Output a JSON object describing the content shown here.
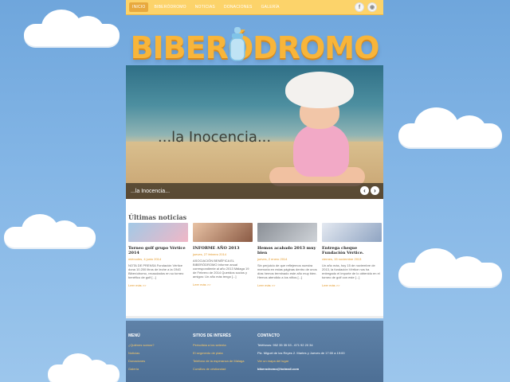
{
  "nav": {
    "items": [
      "Inicio",
      "Biberódromo",
      "Noticias",
      "Donaciones",
      "Galería"
    ],
    "active_index": 0
  },
  "social": [
    "f",
    "rss"
  ],
  "logo": {
    "text": "BIBERÓDROMO"
  },
  "slider": {
    "caption": "...la Inocencia...",
    "title": "...la Inocencia...",
    "prev": "‹",
    "next": "›"
  },
  "news": {
    "section_title": "Últimas noticias",
    "cards": [
      {
        "title": "Torneo golf grupo Vértice 2014",
        "date": "miércoles, 4 junio 2014",
        "excerpt": "NOTA DE PRENSA Fundación Vértice dona 10.200 litros de leche a la ONG Biberódromo, recaudados en su torneo benéfico de golf [...]",
        "more": "Leer más >>"
      },
      {
        "title": "INFORME AÑO 2013",
        "date": "jueves, 27 febrero 2014",
        "excerpt": "ASOCIACIÓN BENÉFICA EL BIBERÓDROMO Informe anual correspondiente al año 2013 Málaga 19 de Febrero de 2014 Queridos socios y amigos: Un año más tengo [...]",
        "more": "Leer más >>"
      },
      {
        "title": "Hemos acabado 2013 muy bien",
        "date": "jueves, 2 enero 2014",
        "excerpt": "Sin perjuicio de que reflejemos nuestra memoria en estas páginas dentro de unos días hemos terminado este año muy bien. Hemos atendido a los niños [...]",
        "more": "Leer más >>"
      },
      {
        "title": "Entrega cheque Fundación Vértice.",
        "date": "viernes, 15 noviembre 2013",
        "excerpt": "Un año más, hoy 15 de noviembre de 2013, la fundación Vértice nos ha entregado el importe de lo obtenido en el torneo de golf con este [...]",
        "more": "Leer más >>"
      }
    ]
  },
  "footer": {
    "menu": {
      "title": "Menú",
      "links": [
        "¿Quiénes somos?",
        "Noticias",
        "Donaciones",
        "Galería"
      ]
    },
    "sites": {
      "title": "Sitios de interés",
      "links": [
        "Periodista a los setenta",
        "El segmento de plata",
        "Teléfono de la esperanza de Málaga",
        "Cursillos de cristiandad"
      ]
    },
    "contact": {
      "title": "Contacto",
      "phone": "Teléfonos: 952 35 35 53 - 671 92 20 34",
      "address": "Plz. Miguel de los Reyes 2. Martes y Jueves de 17:00 a 19:00",
      "map_link": "Ver un mapa del lugar",
      "email": "biberodromo@hotmail.com"
    }
  },
  "colors": {
    "nav_bg": "#fcd36a",
    "accent": "#e39a2c",
    "sky": "#84b6e6",
    "footer": "#5f82a8"
  }
}
